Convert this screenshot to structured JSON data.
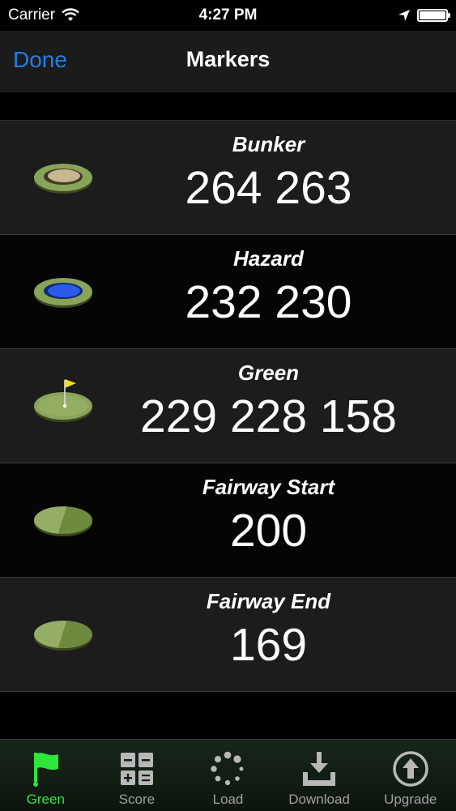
{
  "status_bar": {
    "carrier": "Carrier",
    "time": "4:27 PM",
    "battery_percent": 100
  },
  "nav": {
    "done_label": "Done",
    "title": "Markers"
  },
  "markers": [
    {
      "name": "Bunker",
      "distances": "264 263",
      "icon": "bunker-icon"
    },
    {
      "name": "Hazard",
      "distances": "232 230",
      "icon": "hazard-icon"
    },
    {
      "name": "Green",
      "distances": "229 228 158",
      "icon": "green-flag-icon"
    },
    {
      "name": "Fairway Start",
      "distances": "200",
      "icon": "fairway-start-icon"
    },
    {
      "name": "Fairway End",
      "distances": "169",
      "icon": "fairway-end-icon"
    }
  ],
  "tabs": [
    {
      "label": "Green",
      "icon": "flag-icon",
      "active": true
    },
    {
      "label": "Score",
      "icon": "calculator-icon",
      "active": false
    },
    {
      "label": "Load",
      "icon": "spinner-icon",
      "active": false
    },
    {
      "label": "Download",
      "icon": "download-icon",
      "active": false
    },
    {
      "label": "Upgrade",
      "icon": "upgrade-icon",
      "active": false
    }
  ],
  "colors": {
    "accent": "#1f7fe8",
    "active_tab": "#2de63a"
  }
}
